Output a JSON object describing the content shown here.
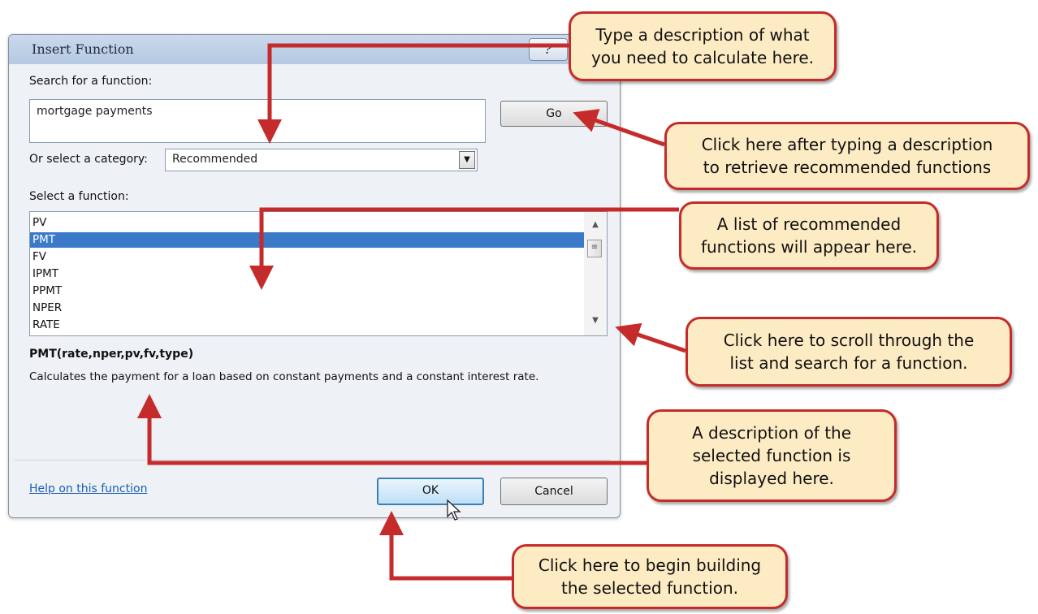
{
  "dialog": {
    "title": "Insert Function",
    "help_icon": "?",
    "search": {
      "label": "Search for a function:",
      "value": "mortgage payments",
      "go_label": "Go"
    },
    "category": {
      "label": "Or select a category:",
      "selected": "Recommended"
    },
    "function_list": {
      "label": "Select a function:",
      "items": [
        "PV",
        "PMT",
        "FV",
        "IPMT",
        "PPMT",
        "NPER",
        "RATE"
      ],
      "selected": "PMT"
    },
    "syntax": "PMT(rate,nper,pv,fv,type)",
    "description": "Calculates the payment for a loan based on constant payments and a constant interest rate.",
    "help_link": "Help on this function",
    "ok_label": "OK",
    "cancel_label": "Cancel"
  },
  "callouts": {
    "type_description": [
      "Type a description of what",
      "you need to calculate here."
    ],
    "click_go": [
      "Click here after typing a description",
      "to retrieve recommended functions"
    ],
    "list_appears": [
      "A list of recommended",
      "functions will appear here."
    ],
    "scroll": [
      "Click here to scroll through the",
      "list and search for a function."
    ],
    "description_shown": [
      "A description of the",
      "selected function is",
      "displayed here."
    ],
    "begin_building": [
      "Click here to begin building",
      "the selected function."
    ]
  },
  "colors": {
    "callout_fill": "#fdebc4",
    "callout_border": "#c62b2b",
    "arrow": "#c62b2b",
    "selection": "#3b7ac9"
  }
}
